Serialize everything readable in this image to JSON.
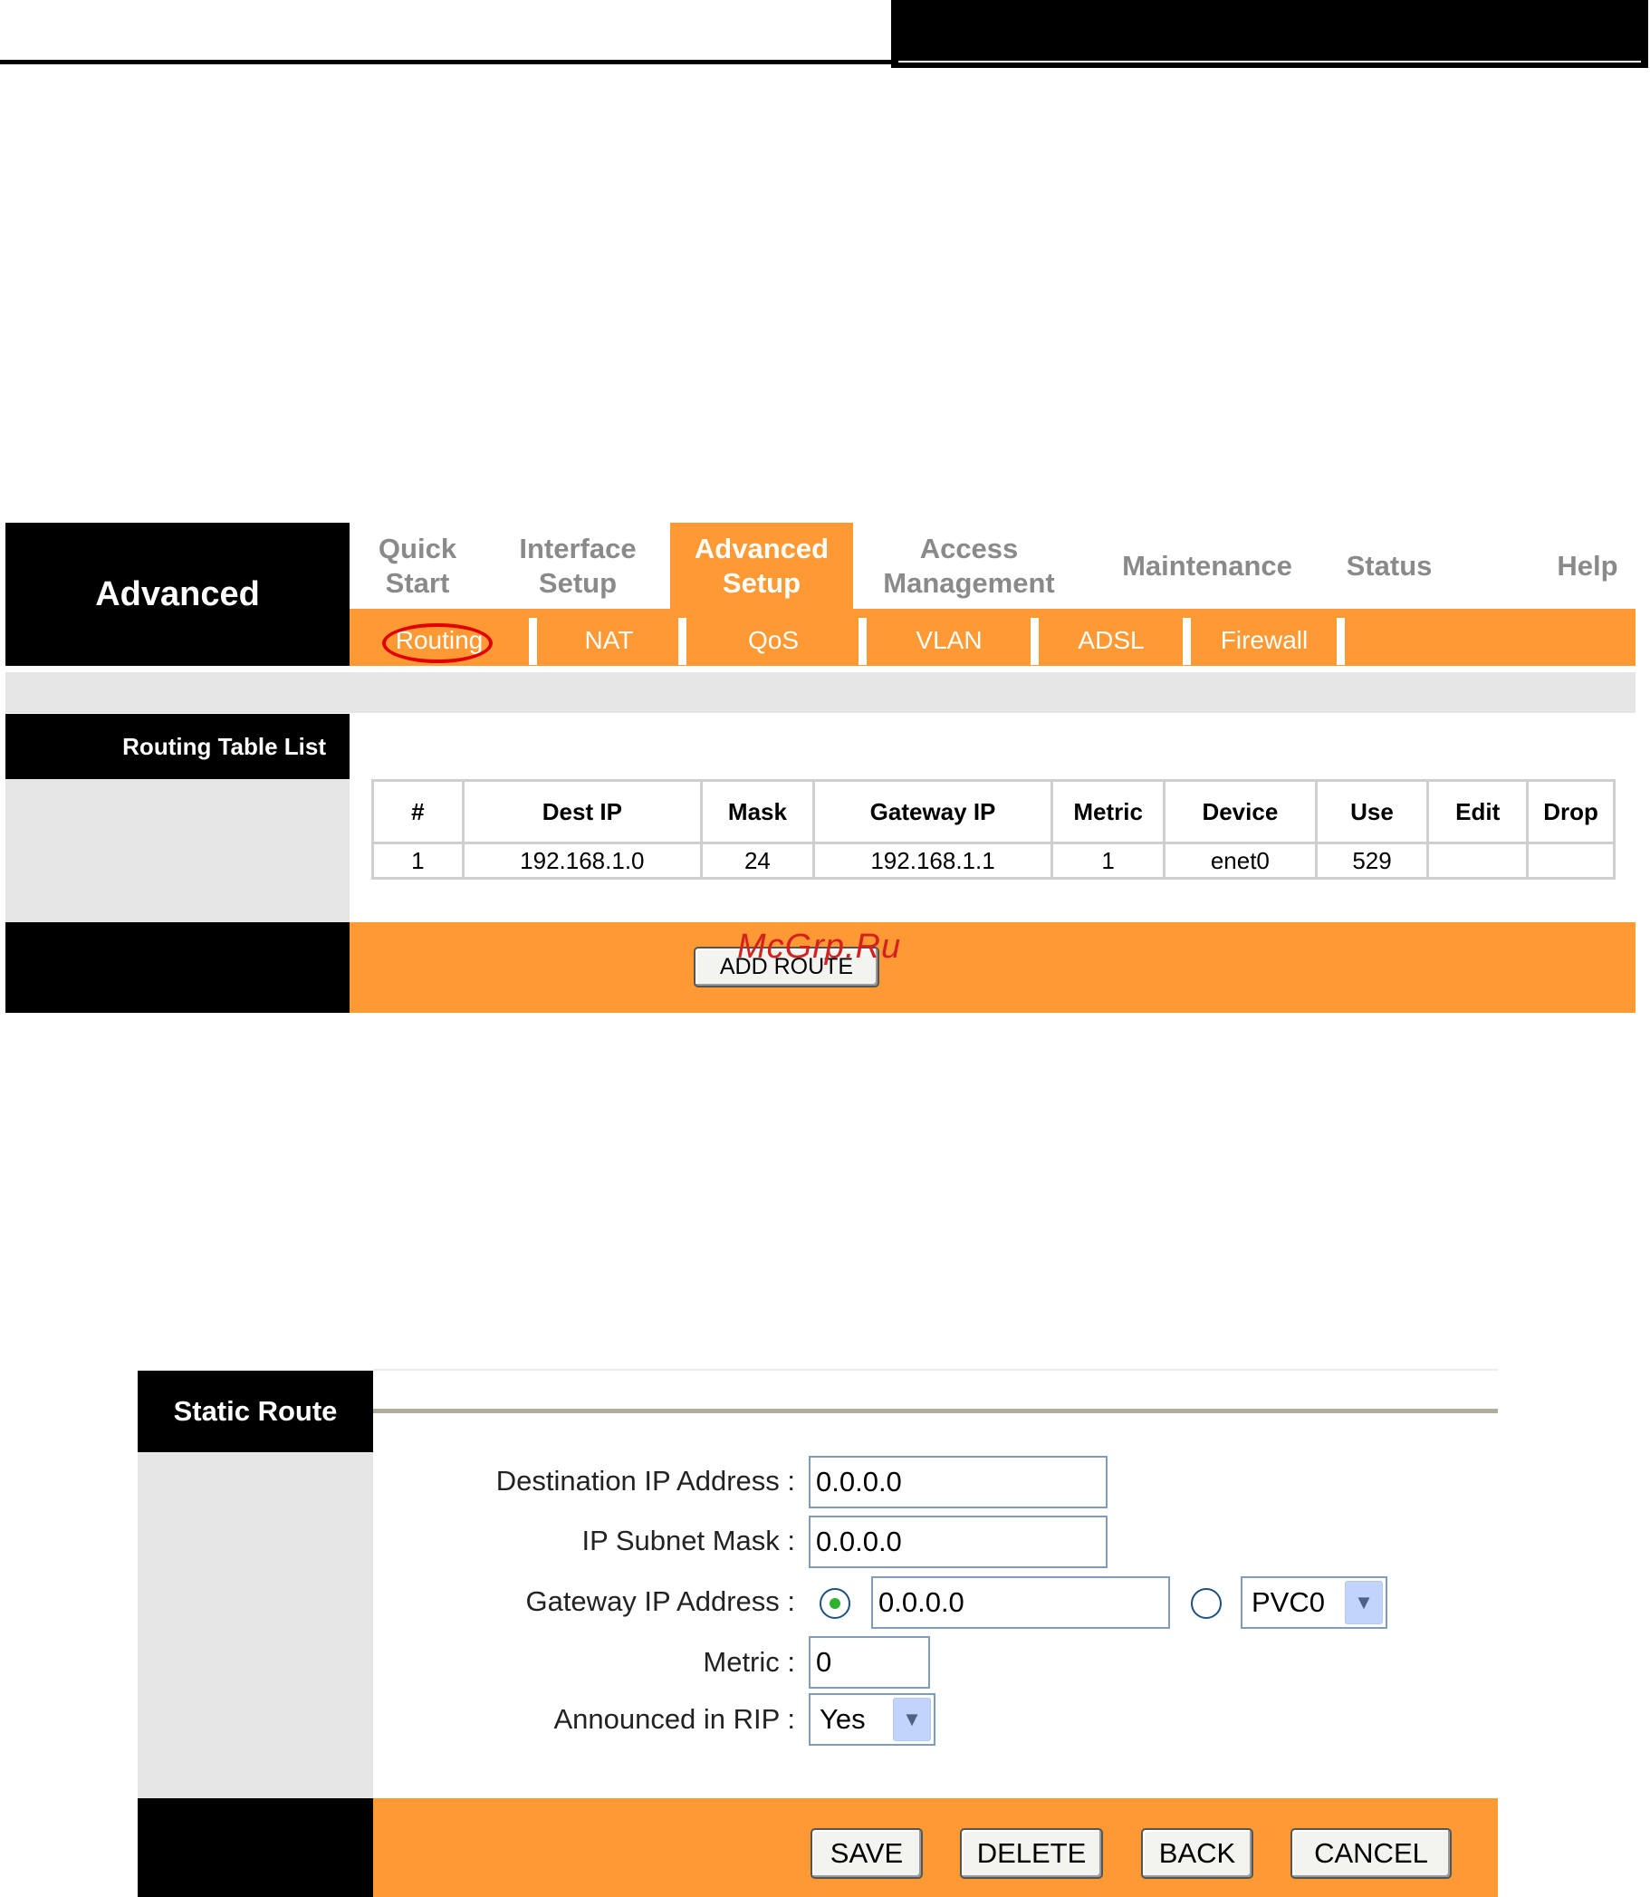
{
  "routing_page": {
    "sidebar_title": "Advanced",
    "main_tabs": [
      {
        "label": "Quick\nStart",
        "active": false
      },
      {
        "label": "Interface\nSetup",
        "active": false
      },
      {
        "label": "Advanced\nSetup",
        "active": true
      },
      {
        "label": "Access\nManagement",
        "active": false
      },
      {
        "label": "Maintenance",
        "active": false
      },
      {
        "label": "Status",
        "active": false
      },
      {
        "label": "Help",
        "active": false
      }
    ],
    "sub_tabs": [
      "Routing",
      "NAT",
      "QoS",
      "VLAN",
      "ADSL",
      "Firewall"
    ],
    "active_sub_tab": "Routing",
    "section_label": "Routing Table List",
    "table": {
      "headers": [
        "#",
        "Dest IP",
        "Mask",
        "Gateway IP",
        "Metric",
        "Device",
        "Use",
        "Edit",
        "Drop"
      ],
      "rows": [
        [
          "1",
          "192.168.1.0",
          "24",
          "192.168.1.1",
          "1",
          "enet0",
          "529",
          "",
          ""
        ]
      ]
    },
    "add_route_label": "ADD ROUTE",
    "watermark": "McGrp.Ru"
  },
  "static_route": {
    "title": "Static Route",
    "fields": {
      "dest_ip_label": "Destination IP Address :",
      "dest_ip_value": "0.0.0.0",
      "subnet_label": "IP Subnet Mask :",
      "subnet_value": "0.0.0.0",
      "gateway_label": "Gateway IP Address :",
      "gateway_value": "0.0.0.0",
      "gateway_mode": "ip",
      "pvc_value": "PVC0",
      "metric_label": "Metric :",
      "metric_value": "0",
      "rip_label": "Announced in RIP :",
      "rip_value": "Yes"
    },
    "buttons": {
      "save": "SAVE",
      "delete": "DELETE",
      "back": "BACK",
      "cancel": "CANCEL"
    }
  },
  "colors": {
    "accent_orange": "#ff9933",
    "header_black": "#000000",
    "panel_gray": "#e6e6e6",
    "highlight_red": "#e00000"
  }
}
